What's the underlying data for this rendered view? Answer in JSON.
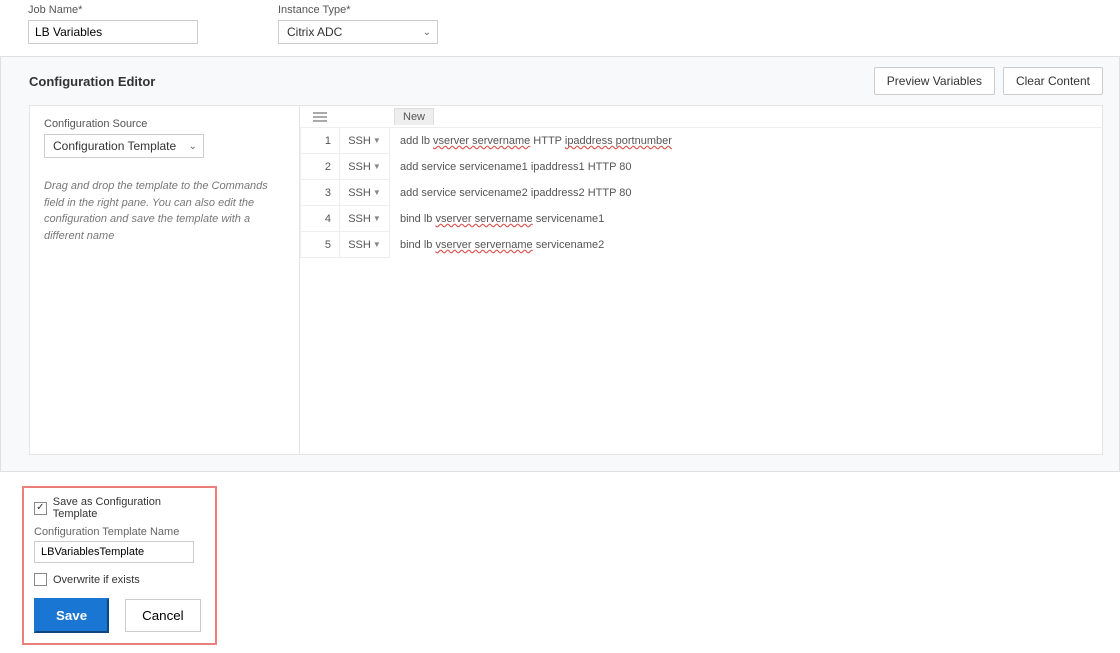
{
  "fields": {
    "job_name_label": "Job Name*",
    "job_name_value": "LB Variables",
    "instance_type_label": "Instance Type*",
    "instance_type_value": "Citrix ADC"
  },
  "panel": {
    "title": "Configuration Editor",
    "preview_btn": "Preview Variables",
    "clear_btn": "Clear Content"
  },
  "source": {
    "label": "Configuration Source",
    "value": "Configuration Template",
    "hint": "Drag and drop the template to the Commands field in the right pane. You can also edit the configuration and save the template with a different name"
  },
  "editor": {
    "tab_new": "New",
    "proto": "SSH",
    "rows": [
      {
        "n": "1",
        "pre": "add lb ",
        "sq": "vserver servername",
        "mid": " HTTP ",
        "sq2": "ipaddress portnumber",
        "post": ""
      },
      {
        "n": "2",
        "pre": "add service servicename1 ipaddress1 HTTP 80",
        "sq": "",
        "mid": "",
        "sq2": "",
        "post": ""
      },
      {
        "n": "3",
        "pre": "add service servicename2 ipaddress2 HTTP 80",
        "sq": "",
        "mid": "",
        "sq2": "",
        "post": ""
      },
      {
        "n": "4",
        "pre": "bind lb ",
        "sq": "vserver servername",
        "mid": " servicename1",
        "sq2": "",
        "post": ""
      },
      {
        "n": "5",
        "pre": "bind lb ",
        "sq": "vserver servername",
        "mid": " servicename2",
        "sq2": "",
        "post": ""
      }
    ]
  },
  "save": {
    "chk_label": "Save as Configuration Template",
    "name_label": "Configuration Template Name",
    "name_value": "LBVariablesTemplate",
    "overwrite_label": "Overwrite if exists",
    "save_btn": "Save",
    "cancel_btn": "Cancel"
  }
}
